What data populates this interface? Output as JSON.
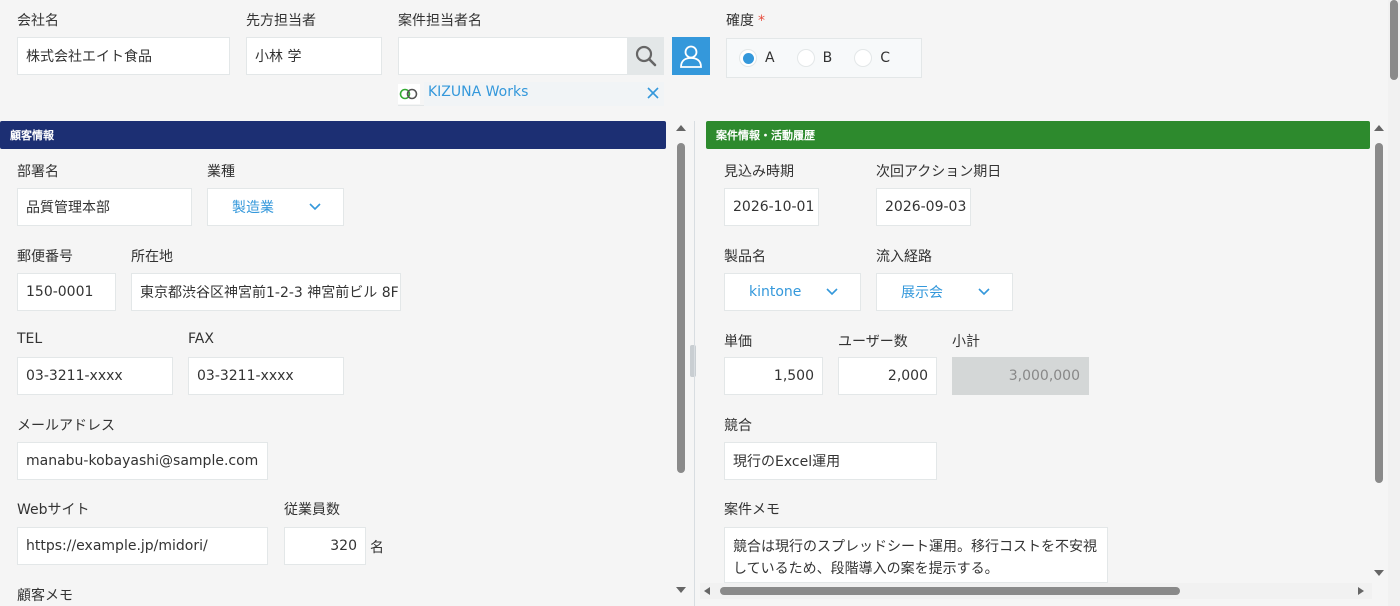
{
  "header": {
    "company_label": "会社名",
    "company_value": "株式会社エイト食品",
    "contact_label": "先方担当者",
    "contact_value": "小林 学",
    "owner_label": "案件担当者名",
    "owner_value": "",
    "owner_tag": "KIZUNA Works",
    "certainty_label": "確度",
    "certainty_required": "*",
    "certainty_options": [
      "A",
      "B",
      "C"
    ],
    "certainty_selected": "A"
  },
  "left": {
    "section_title": "顧客情報",
    "dept_label": "部署名",
    "dept_value": "品質管理本部",
    "industry_label": "業種",
    "industry_value": "製造業",
    "zip_label": "郵便番号",
    "zip_value": "150-0001",
    "address_label": "所在地",
    "address_value": "東京都渋谷区神宮前1-2-3 神宮前ビル 8F",
    "tel_label": "TEL",
    "tel_value": "03-3211-xxxx",
    "fax_label": "FAX",
    "fax_value": "03-3211-xxxx",
    "email_label": "メールアドレス",
    "email_value": "manabu-kobayashi@sample.com",
    "web_label": "Webサイト",
    "web_value": "https://example.jp/midori/",
    "employees_label": "従業員数",
    "employees_value": "320",
    "employees_unit": "名",
    "memo_label": "顧客メモ"
  },
  "right": {
    "section_title": "案件情報・活動履歴",
    "expected_label": "見込み時期",
    "expected_value": "2026-10-01",
    "next_action_label": "次回アクション期日",
    "next_action_value": "2026-09-03",
    "product_label": "製品名",
    "product_value": "kintone",
    "source_label": "流入経路",
    "source_value": "展示会",
    "price_label": "単価",
    "price_value": "1,500",
    "users_label": "ユーザー数",
    "users_value": "2,000",
    "subtotal_label": "小計",
    "subtotal_value": "3,000,000",
    "competitor_label": "競合",
    "competitor_value": "現行のExcel運用",
    "memo_label": "案件メモ",
    "memo_value": "競合は現行のスプレッドシート運用。移行コストを不安視しているため、段階導入の案を提示する。"
  },
  "colors": {
    "left_section": "#1c2f73",
    "right_section": "#2d8a2d",
    "accent": "#3498db"
  },
  "icons": [
    "search-icon",
    "user-icon",
    "chevron-down-icon",
    "kizuna-logo-icon",
    "close-icon"
  ]
}
